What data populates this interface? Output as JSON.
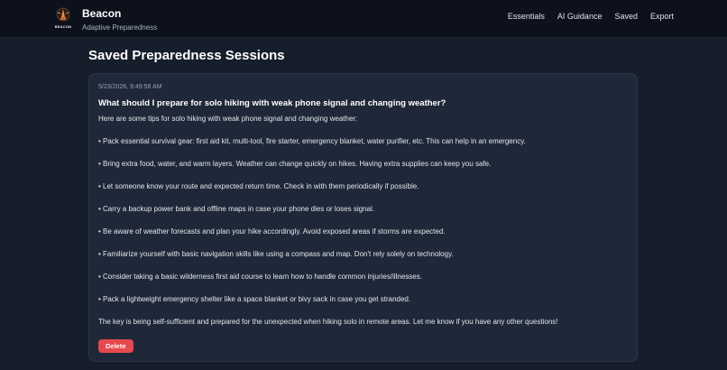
{
  "header": {
    "logo_text": "BEACON",
    "title": "Beacon",
    "subtitle": "Adaptive Preparedness",
    "nav": [
      "Essentials",
      "AI Guidance",
      "Saved",
      "Export"
    ]
  },
  "main": {
    "title": "Saved Preparedness Sessions",
    "session": {
      "timestamp": "5/23/2026, 9:49:58 AM",
      "question": "What should I prepare for solo hiking with weak phone signal and changing weather?",
      "answer": [
        "Here are some tips for solo hiking with weak phone signal and changing weather:",
        "• Pack essential survival gear: first aid kit, multi-tool, fire starter, emergency blanket, water purifier, etc. This can help in an emergency.",
        "• Bring extra food, water, and warm layers. Weather can change quickly on hikes. Having extra supplies can keep you safe.",
        "• Let someone know your route and expected return time. Check in with them periodically if possible.",
        "• Carry a backup power bank and offline maps in case your phone dies or loses signal.",
        "• Be aware of weather forecasts and plan your hike accordingly. Avoid exposed areas if storms are expected.",
        "• Familiarize yourself with basic navigation skills like using a compass and map. Don't rely solely on technology.",
        "• Consider taking a basic wilderness first aid course to learn how to handle common injuries/illnesses.",
        "• Pack a lightweight emergency shelter like a space blanket or bivy sack in case you get stranded.",
        "The key is being self-sufficient and prepared for the unexpected when hiking solo in remote areas. Let me know if you have any other questions!"
      ],
      "delete_label": "Delete"
    }
  },
  "colors": {
    "background": "#161d2b",
    "header": "#0c111b",
    "card": "#1f2838",
    "danger": "#e5484d"
  }
}
